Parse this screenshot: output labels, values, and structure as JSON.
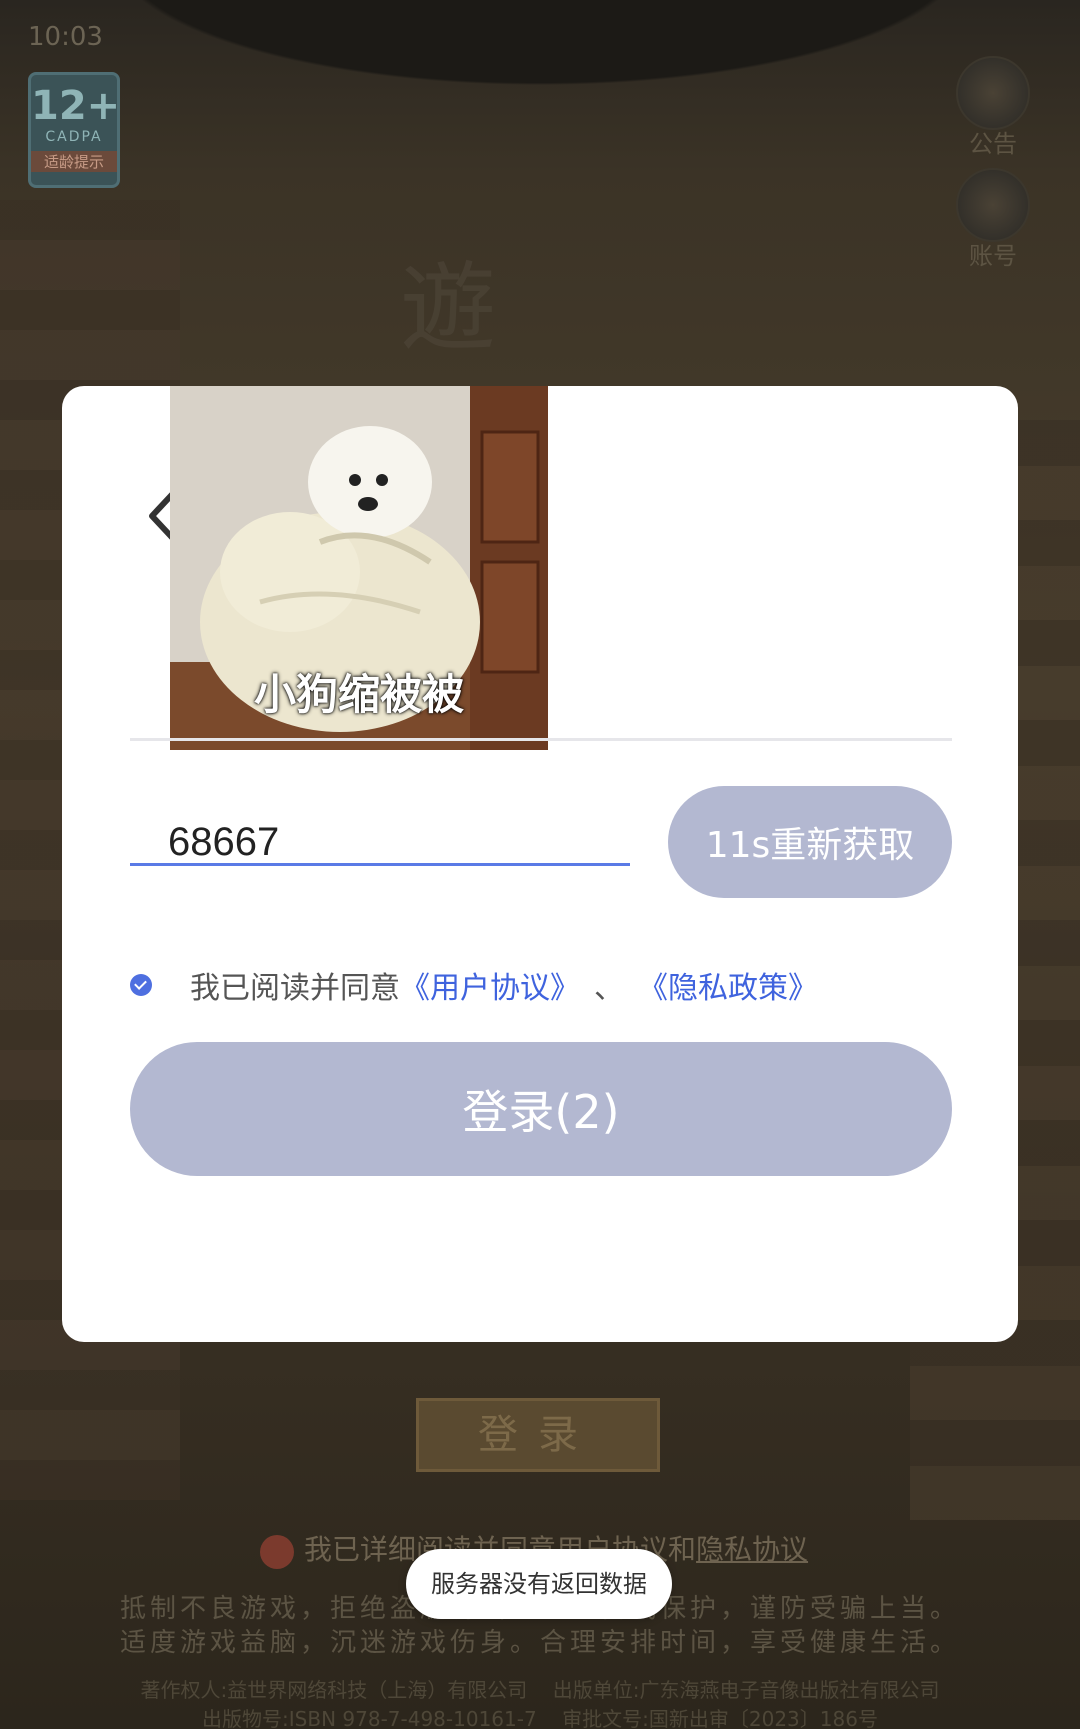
{
  "status_bar": {
    "time": "10:03"
  },
  "age_badge": {
    "age": "12+",
    "org": "CADPA",
    "tip": "适龄提示"
  },
  "side_buttons": {
    "notice_label": "公告",
    "account_label": "账号"
  },
  "background": {
    "title_glyph": "遊",
    "login_button": "登录",
    "agreement_prefix": "我已详细阅读并同意",
    "agreement_user": "用户协议",
    "agreement_and": "和",
    "agreement_privacy": "隐私协议",
    "notice_line1": "抵制不良游戏，拒绝盗版游戏。注意自我保护，谨防受骗上当。",
    "notice_line2": "适度游戏益脑，沉迷游戏伤身。合理安排时间，享受健康生活。",
    "credits_line1_left": "著作权人:益世界网络科技（上海）有限公司",
    "credits_line1_right": "出版单位:广东海燕电子音像出版社有限公司",
    "credits_line2_left": "出版物号:ISBN 978-7-498-10161-7",
    "credits_line2_right": "审批文号:国新出审〔2023〕186号"
  },
  "modal": {
    "sticker_caption": "小狗缩被被",
    "code_value": "68667",
    "resend_label": "11s重新获取",
    "agree_text": "我已阅读并同意",
    "user_agreement": "《用户协议》",
    "separator": "、",
    "privacy_policy": "《隐私政策》",
    "agree_checked": true,
    "login_label": "登录(2)",
    "colors": {
      "accent": "#3f63de",
      "disabled_button": "#b3b8d1"
    }
  },
  "toast": {
    "message": "服务器没有返回数据"
  }
}
